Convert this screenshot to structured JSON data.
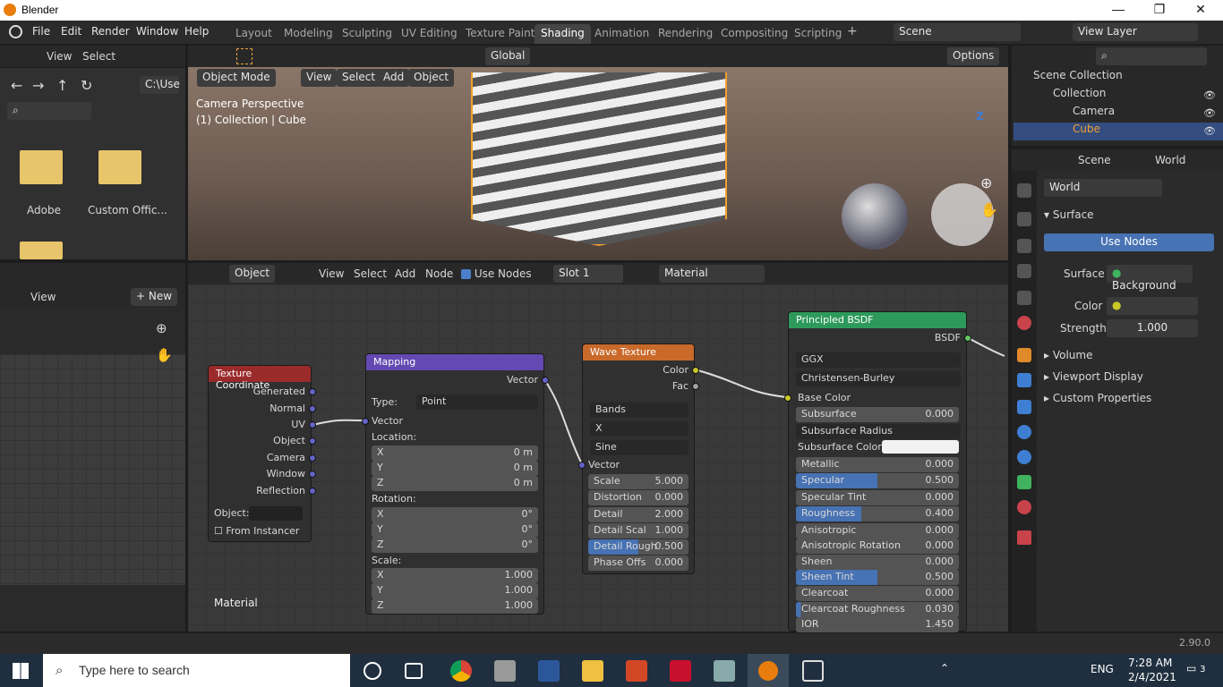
{
  "window": {
    "title": "Blender",
    "version": "2.90.0"
  },
  "menu": [
    "File",
    "Edit",
    "Render",
    "Window",
    "Help"
  ],
  "workspaces": [
    "Layout",
    "Modeling",
    "Sculpting",
    "UV Editing",
    "Texture Paint",
    "Shading",
    "Animation",
    "Rendering",
    "Compositing",
    "Scripting"
  ],
  "active_workspace": "Shading",
  "scene": {
    "name": "Scene",
    "view_layer": "View Layer"
  },
  "filebrowser": {
    "menu": [
      "View",
      "Select"
    ],
    "path": "C:\\Use",
    "folders": [
      "Adobe",
      "Custom Offic..."
    ]
  },
  "imageeditor": {
    "view": "View",
    "new": "New"
  },
  "viewport": {
    "mode": "Object Mode",
    "menus": [
      "View",
      "Select",
      "Add",
      "Object"
    ],
    "orientation": "Global",
    "options": "Options",
    "overlay1": "Camera Perspective",
    "overlay2": "(1) Collection | Cube"
  },
  "node_editor": {
    "type": "Object",
    "menus": [
      "View",
      "Select",
      "Add",
      "Node"
    ],
    "use_nodes": "Use Nodes",
    "slot": "Slot 1",
    "material": "Material",
    "label": "Material",
    "texcoord": {
      "title": "Texture Coordinate",
      "outputs": [
        "Generated",
        "Normal",
        "UV",
        "Object",
        "Camera",
        "Window",
        "Reflection"
      ],
      "object_label": "Object:",
      "from_instancer": "From Instancer"
    },
    "mapping": {
      "title": "Mapping",
      "vector_out": "Vector",
      "type_label": "Type:",
      "type": "Point",
      "vector_in": "Vector",
      "location": "Location:",
      "rotation": "Rotation:",
      "scale": "Scale:",
      "loc": [
        [
          "X",
          "0 m"
        ],
        [
          "Y",
          "0 m"
        ],
        [
          "Z",
          "0 m"
        ]
      ],
      "rot": [
        [
          "X",
          "0°"
        ],
        [
          "Y",
          "0°"
        ],
        [
          "Z",
          "0°"
        ]
      ],
      "scl": [
        [
          "X",
          "1.000"
        ],
        [
          "Y",
          "1.000"
        ],
        [
          "Z",
          "1.000"
        ]
      ]
    },
    "wave": {
      "title": "Wave Texture",
      "out_color": "Color",
      "out_fac": "Fac",
      "type": "Bands",
      "dir": "X",
      "profile": "Sine",
      "vector": "Vector",
      "fields": [
        [
          "Scale",
          "5.000"
        ],
        [
          "Distortion",
          "0.000"
        ],
        [
          "Detail",
          "2.000"
        ],
        [
          "Detail Scal",
          "1.000"
        ],
        [
          "Detail Rough",
          "0.500"
        ],
        [
          "Phase Offs",
          "0.000"
        ]
      ]
    },
    "bsdf": {
      "title": "Principled BSDF",
      "out": "BSDF",
      "dist": "GGX",
      "sss": "Christensen-Burley",
      "base_color": "Base Color",
      "subsurface_radius": "Subsurface Radius",
      "subsurface_color": "Subsurface Color",
      "fields": [
        [
          "Subsurface",
          "0.000"
        ],
        [
          "Metallic",
          "0.000"
        ],
        [
          "Specular",
          "0.500"
        ],
        [
          "Specular Tint",
          "0.000"
        ],
        [
          "Roughness",
          "0.400"
        ],
        [
          "Anisotropic",
          "0.000"
        ],
        [
          "Anisotropic Rotation",
          "0.000"
        ],
        [
          "Sheen",
          "0.000"
        ],
        [
          "Sheen Tint",
          "0.500"
        ],
        [
          "Clearcoat",
          "0.000"
        ],
        [
          "Clearcoat Roughness",
          "0.030"
        ],
        [
          "IOR",
          "1.450"
        ]
      ]
    }
  },
  "outliner": {
    "items": [
      "Scene Collection",
      "Collection",
      "Camera",
      "Cube"
    ]
  },
  "properties": {
    "tabs": [
      "Scene",
      "World"
    ],
    "world": "World",
    "surface": "Surface",
    "use_nodes": "Use Nodes",
    "surface_label": "Surface",
    "surface_value": "Background",
    "color": "Color",
    "strength": "Strength",
    "strength_value": "1.000",
    "sections": [
      "Volume",
      "Viewport Display",
      "Custom Properties"
    ]
  },
  "taskbar": {
    "search": "Type here to search",
    "time": "7:28 AM",
    "date": "2/4/2021",
    "lang": "ENG",
    "notif": "3"
  }
}
